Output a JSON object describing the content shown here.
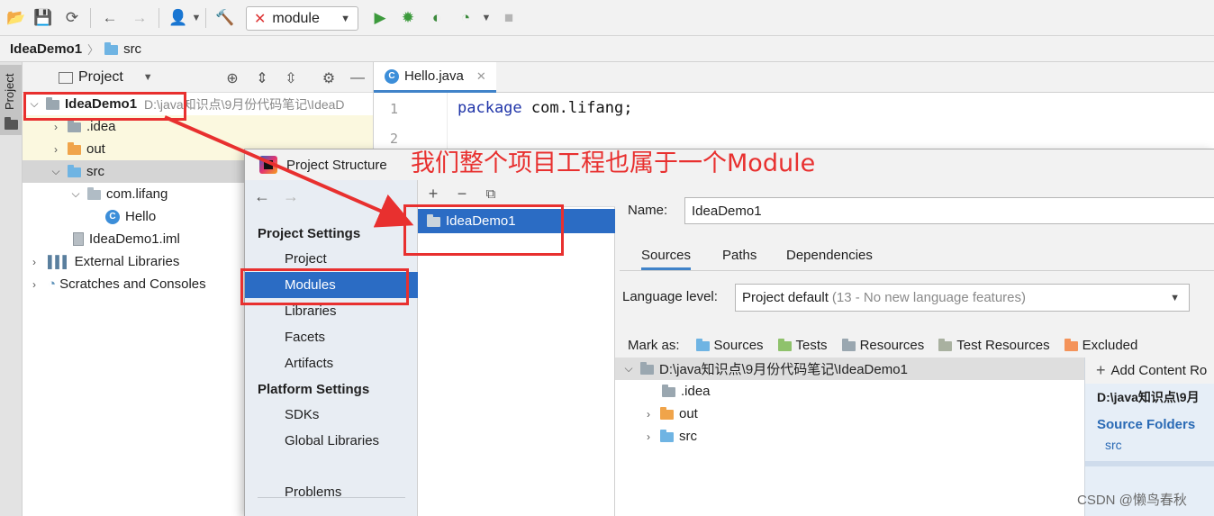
{
  "toolbar": {
    "run_config": "module",
    "icons": [
      "open-folder-icon",
      "save-icon",
      "sync-icon",
      "back-icon",
      "forward-icon",
      "user-icon",
      "build-hammer-icon",
      "run-icon",
      "debug-icon",
      "coverage-icon",
      "profile-icon",
      "stop-icon"
    ]
  },
  "navbar": {
    "project": "IdeaDemo1",
    "folder": "src"
  },
  "side_tab": "Project",
  "project_panel": {
    "title": "Project",
    "tree": [
      {
        "label": "IdeaDemo1",
        "hint": "D:\\java知识点\\9月份代码笔记\\IdeaD"
      },
      {
        "label": ".idea"
      },
      {
        "label": "out"
      },
      {
        "label": "src"
      },
      {
        "label": "com.lifang"
      },
      {
        "label": "Hello"
      },
      {
        "label": "IdeaDemo1.iml"
      },
      {
        "label": "External Libraries"
      },
      {
        "label": "Scratches and Consoles"
      }
    ]
  },
  "editor": {
    "tab": "Hello.java",
    "lines": [
      "1",
      "2"
    ],
    "code_keyword": "package",
    "code_rest": " com.lifang;"
  },
  "dialog": {
    "title": "Project Structure",
    "project_settings": "Project Settings",
    "project_items": [
      "Project",
      "Modules",
      "Libraries",
      "Facets",
      "Artifacts"
    ],
    "platform_settings": "Platform Settings",
    "platform_items": [
      "SDKs",
      "Global Libraries"
    ],
    "problems": "Problems",
    "module": "IdeaDemo1",
    "name_label": "Name:",
    "name_value": "IdeaDemo1",
    "tabs": [
      "Sources",
      "Paths",
      "Dependencies"
    ],
    "language_label": "Language level:",
    "language_value": "Project default",
    "language_hint": "(13 - No new language features)",
    "mark_as": "Mark as:",
    "marks": [
      "Sources",
      "Tests",
      "Resources",
      "Test Resources",
      "Excluded"
    ],
    "content_root": "D:\\java知识点\\9月份代码笔记\\IdeaDemo1",
    "content_children": [
      ".idea",
      "out",
      "src"
    ],
    "add_content_root": "Add Content Ro",
    "side_path": "D:\\java知识点\\9月",
    "source_folders": "Source Folders",
    "source_item": "src"
  },
  "annotation": "我们整个项目工程也属于一个Module",
  "watermark": "CSDN @懒鸟春秋",
  "colors": {
    "selection": "#2b6cc4",
    "annotation": "#e8302f",
    "accent": "#4083c9"
  }
}
